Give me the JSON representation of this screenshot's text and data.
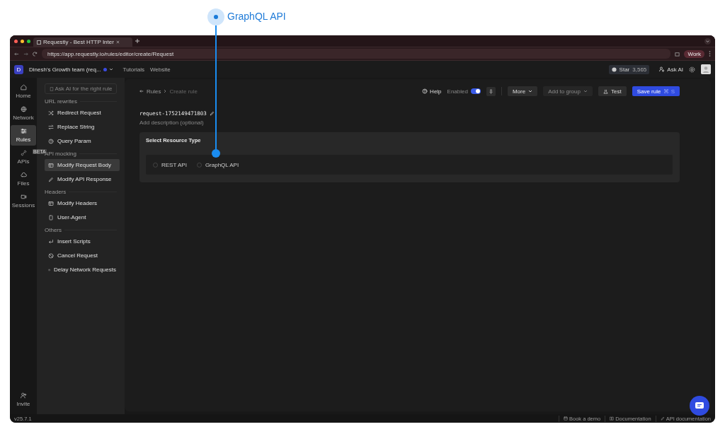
{
  "callout": {
    "label": "GraphQL API"
  },
  "browser": {
    "tab_title": "Requestly - Best HTTP Inter",
    "url": "https://app.requestly.io/rules/editor/create/Request",
    "profile": "Work"
  },
  "header": {
    "team_initial": "D",
    "team_name": "Dinesh's Growth team (req...",
    "links": [
      "Tutorials",
      "Website"
    ],
    "github_label": "Star",
    "github_count": "3,565",
    "ask_ai": "Ask AI"
  },
  "rail": {
    "items": [
      {
        "label": "Home",
        "selected": false
      },
      {
        "label": "Network",
        "selected": false
      },
      {
        "label": "Rules",
        "selected": true
      },
      {
        "label": "APIs",
        "selected": false,
        "badge": "BETA"
      },
      {
        "label": "Files",
        "selected": false
      },
      {
        "label": "Sessions",
        "selected": false
      }
    ],
    "bottom": {
      "label": "Invite"
    }
  },
  "sidebar": {
    "search_placeholder": "Ask AI for the right rule",
    "groups": [
      {
        "title": "URL rewrites",
        "items": [
          {
            "label": "Redirect Request",
            "selected": false
          },
          {
            "label": "Replace String",
            "selected": false
          },
          {
            "label": "Query Param",
            "selected": false
          }
        ]
      },
      {
        "title": "API mocking",
        "items": [
          {
            "label": "Modify Request Body",
            "selected": true
          },
          {
            "label": "Modify API Response",
            "selected": false
          }
        ]
      },
      {
        "title": "Headers",
        "items": [
          {
            "label": "Modify Headers",
            "selected": false
          },
          {
            "label": "User-Agent",
            "selected": false
          }
        ]
      },
      {
        "title": "Others",
        "items": [
          {
            "label": "Insert Scripts",
            "selected": false
          },
          {
            "label": "Cancel Request",
            "selected": false
          },
          {
            "label": "Delay Network Requests",
            "selected": false
          }
        ]
      }
    ]
  },
  "breadcrumb": [
    "Rules",
    "Create rule"
  ],
  "toolbar": {
    "help": "Help",
    "enabled_label": "Enabled",
    "enabled": true,
    "more": "More",
    "add_to_group": "Add to group",
    "add_to_group_disabled": true,
    "test": "Test",
    "save": "Save rule",
    "save_shortcut": "⌘ S"
  },
  "rule": {
    "name": "request-1752149471803",
    "description_placeholder": "Add description (optional)"
  },
  "resource": {
    "title": "Select Resource Type",
    "options": [
      {
        "label": "REST API",
        "selected": false
      },
      {
        "label": "GraphQL API",
        "selected": false
      }
    ]
  },
  "footer": {
    "version": "v25.7.1",
    "links": [
      "Book a demo",
      "Documentation",
      "API documentation"
    ]
  }
}
